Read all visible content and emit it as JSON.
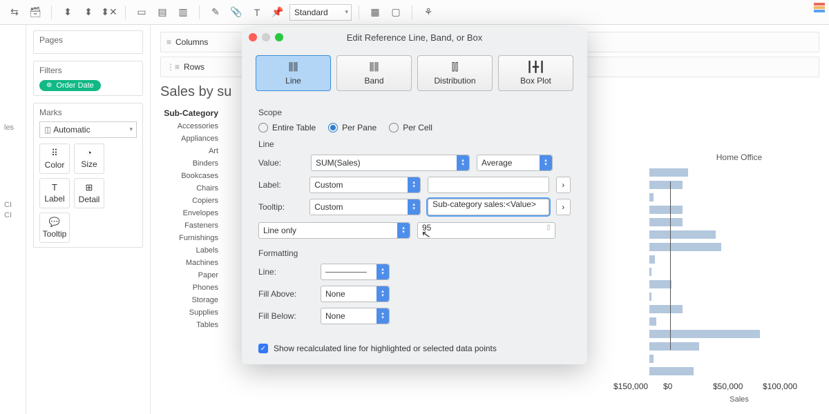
{
  "toolbar": {
    "format_select": "Standard"
  },
  "shelves": {
    "columns": "Columns",
    "rows": "Rows"
  },
  "pages": {
    "title": "Pages"
  },
  "filters": {
    "title": "Filters",
    "pill": "Order Date"
  },
  "marks": {
    "title": "Marks",
    "type": "Automatic",
    "btns": [
      "Color",
      "Size",
      "Label",
      "Detail",
      "Tooltip"
    ]
  },
  "left_truncated": [
    "les",
    "CI",
    "CI"
  ],
  "sheet": {
    "title": "Sales by su",
    "subcat_header": "Sub-Category",
    "subcats": [
      "Accessories",
      "Appliances",
      "Art",
      "Binders",
      "Bookcases",
      "Chairs",
      "Copiers",
      "Envelopes",
      "Fasteners",
      "Furnishings",
      "Labels",
      "Machines",
      "Paper",
      "Phones",
      "Storage",
      "Supplies",
      "Tables"
    ]
  },
  "right_chart": {
    "header": "Home Office",
    "axis": [
      "$150,000",
      "$0",
      "$50,000",
      "$100,000"
    ],
    "axis_title": "Sales",
    "bars": [
      35,
      30,
      4,
      30,
      30,
      60,
      65,
      5,
      2,
      20,
      2,
      30,
      6,
      100,
      45,
      4,
      40
    ]
  },
  "modal": {
    "title": "Edit Reference Line, Band, or Box",
    "tabs": [
      "Line",
      "Band",
      "Distribution",
      "Box Plot"
    ],
    "scope": {
      "title": "Scope",
      "options": [
        "Entire Table",
        "Per Pane",
        "Per Cell"
      ],
      "selected": 1
    },
    "line": {
      "title": "Line",
      "value_label": "Value:",
      "value": "SUM(Sales)",
      "agg": "Average",
      "label_label": "Label:",
      "label": "Custom",
      "label_text": "",
      "tooltip_label": "Tooltip:",
      "tooltip": "Custom",
      "tooltip_text": "Sub-category sales:<Value>",
      "line_only": "Line only",
      "conf": "95"
    },
    "formatting": {
      "title": "Formatting",
      "line_label": "Line:",
      "fill_above_label": "Fill Above:",
      "fill_above": "None",
      "fill_below_label": "Fill Below:",
      "fill_below": "None"
    },
    "recalc": "Show recalculated line for highlighted or selected data points"
  }
}
